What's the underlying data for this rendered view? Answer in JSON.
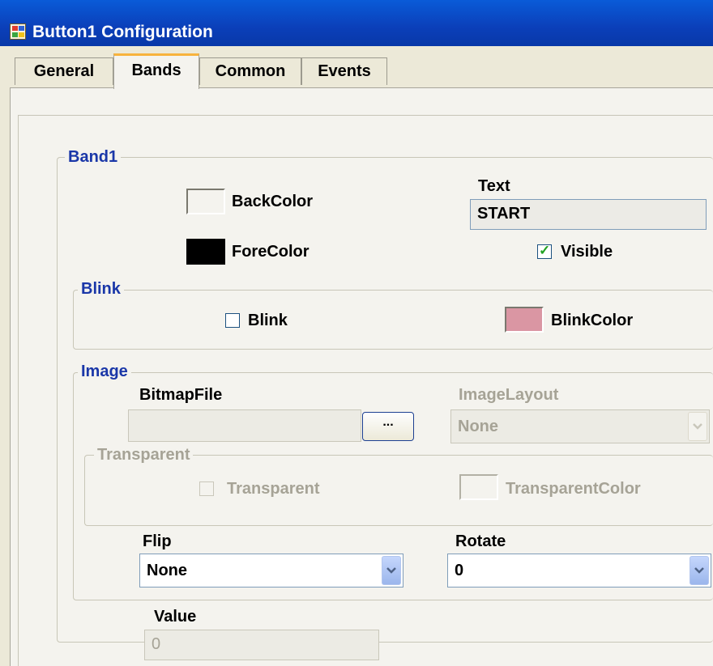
{
  "window": {
    "title": "Button1 Configuration"
  },
  "tabs": [
    {
      "label": "General"
    },
    {
      "label": "Bands"
    },
    {
      "label": "Common"
    },
    {
      "label": "Events"
    }
  ],
  "active_tab": "Bands",
  "band1": {
    "legend": "Band1",
    "back_color_label": "BackColor",
    "back_color": "#ece9d8",
    "fore_color_label": "ForeColor",
    "fore_color": "#000000",
    "text_label": "Text",
    "text_value": "START",
    "visible_label": "Visible",
    "visible_checked": true
  },
  "blink": {
    "legend": "Blink",
    "blink_label": "Blink",
    "blink_checked": false,
    "blink_color_label": "BlinkColor",
    "blink_color": "#da96a3"
  },
  "image": {
    "legend": "Image",
    "bitmap_label": "BitmapFile",
    "bitmap_value": "",
    "browse_label": "...",
    "layout_label": "ImageLayout",
    "layout_value": "None",
    "transparent_group": {
      "legend": "Transparent",
      "transparent_label": "Transparent",
      "transparent_color_label": "TransparentColor"
    },
    "flip_label": "Flip",
    "flip_value": "None",
    "rotate_label": "Rotate",
    "rotate_value": "0"
  },
  "value": {
    "label": "Value",
    "value": "0"
  }
}
